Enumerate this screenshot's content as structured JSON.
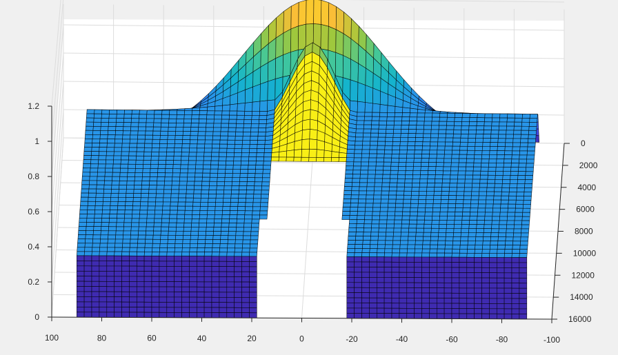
{
  "chart_data": {
    "type": "surface",
    "title": "",
    "xlabel": "",
    "ylabel": "",
    "zlabel": "",
    "grid": true,
    "colormap": "parula",
    "x_ticks": [
      "100",
      "80",
      "60",
      "40",
      "20",
      "0",
      "-20",
      "-40",
      "-60",
      "-80",
      "-100"
    ],
    "x_tick_values": [
      100,
      80,
      60,
      40,
      20,
      0,
      -20,
      -40,
      -60,
      -80,
      -100
    ],
    "xlim": [
      -100,
      100
    ],
    "y_ticks": [
      "0",
      "2000",
      "4000",
      "6000",
      "8000",
      "10000",
      "12000",
      "14000",
      "16000"
    ],
    "y_tick_values": [
      0,
      2000,
      4000,
      6000,
      8000,
      10000,
      12000,
      14000,
      16000
    ],
    "ylim": [
      0,
      16000
    ],
    "z_ticks": [
      "0",
      "0.2",
      "0.4",
      "0.6",
      "0.8",
      "1",
      "1.2"
    ],
    "z_tick_values": [
      0,
      0.2,
      0.4,
      0.6,
      0.8,
      1,
      1.2
    ],
    "zlim": [
      0,
      1.2
    ],
    "surface": {
      "back_profile_peak": 1.0,
      "back_profile_width": 28,
      "flat_level": 0.35,
      "hole_x_range": [
        -15,
        15
      ],
      "colors": {
        "low": "#3e26a8",
        "mid": "#2fb8c8",
        "high": "#f9fb0e",
        "peak": "#fcb040"
      }
    }
  }
}
